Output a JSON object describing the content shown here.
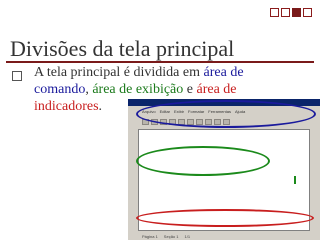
{
  "slide": {
    "title": "Divisões da tela principal",
    "bullet": {
      "text_1": "A tela principal é dividida em ",
      "area_command_1": "área de",
      "area_command_2": "comando",
      "sep_1": ", ",
      "area_display": "área de exibição",
      "sep_2": " e ",
      "area_indicators_1": "área de",
      "area_indicators_2": "indicadores",
      "end": "."
    }
  },
  "screenshot": {
    "menu": [
      "Arquivo",
      "Editar",
      "Exibir",
      "Formatar",
      "Ferramentas",
      "Ajuda"
    ],
    "status": [
      "Página 1",
      "Seção 1",
      "1/1"
    ]
  },
  "colors": {
    "title_rule": "#7a1a1a",
    "command": "#1a1a9c",
    "display": "#1b7a1b",
    "indicators": "#c81e1e"
  }
}
